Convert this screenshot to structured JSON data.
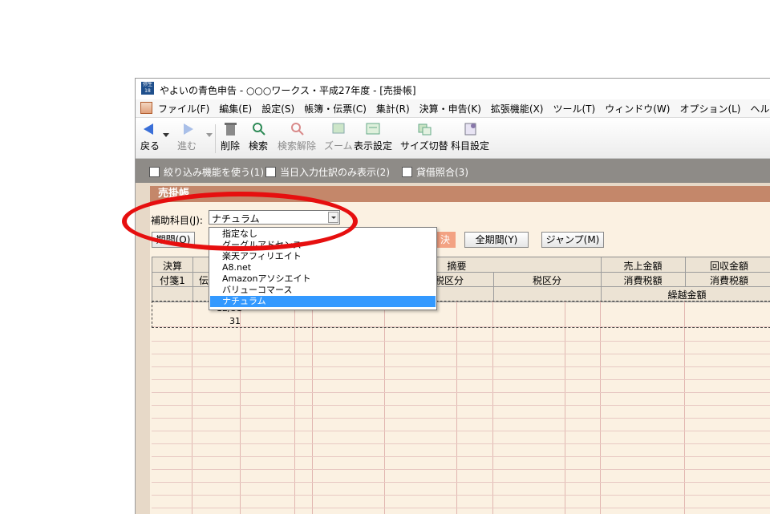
{
  "window": {
    "icon_text": "弥生 18",
    "title": "やよいの青色申告 - ○○○ワークス・平成27年度 - [売掛帳]"
  },
  "menu": [
    "ファイル(F)",
    "編集(E)",
    "設定(S)",
    "帳簿・伝票(C)",
    "集計(R)",
    "決算・申告(K)",
    "拡張機能(X)",
    "ツール(T)",
    "ウィンドウ(W)",
    "オプション(L)",
    "ヘルプ(H)"
  ],
  "toolbar": {
    "back": "戻る",
    "forward": "進む",
    "delete": "削除",
    "search": "検索",
    "clear_search": "検索解除",
    "zoom": "ズーム",
    "display_settings": "表示設定",
    "size_toggle": "サイズ切替",
    "account_settings": "科目設定"
  },
  "filters": {
    "narrow": "絞り込み機能を使う(1)",
    "today_only": "当日入力仕訳のみ表示(2)",
    "balance_check": "貸借照合(3)"
  },
  "panel": {
    "title": "売掛帳",
    "sub_account_label": "補助科目(J):",
    "sub_account_value": "ナチュラム"
  },
  "buttons": {
    "period": "期間(O)",
    "settle": "決",
    "full_period": "全期間(Y)",
    "jump": "ジャンプ(M)"
  },
  "table": {
    "h_settle": "決算",
    "h_sticky": "付箋1",
    "h_den": "伝",
    "h_summary": "摘要",
    "h_tax1": "税区分",
    "h_tax2": "税区分",
    "h_sales": "売上金額",
    "h_collect": "回収金額",
    "h_tax_sales": "消費税額",
    "h_tax_collect": "消費税額",
    "h_carry": "繰越金額",
    "row_date": "12/31",
    "row_day": "31"
  },
  "dropdown": {
    "items": [
      "指定なし",
      "グーグルアドセンス",
      "楽天アフィリエイト",
      "A8.net",
      "Amazonアソシエイト",
      "バリューコマース",
      "ナチュラム"
    ],
    "selected_index": 6
  },
  "colors": {
    "highlight": "#e60f0f",
    "selection": "#3399ff",
    "panel_header": "#c4876a"
  }
}
